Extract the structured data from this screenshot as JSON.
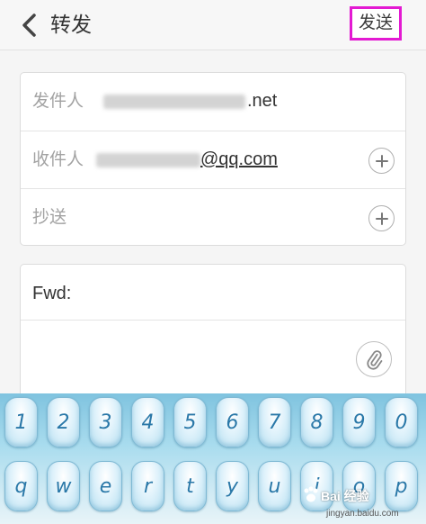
{
  "header": {
    "title": "转发",
    "send_label": "发送"
  },
  "form": {
    "from_label": "发件人",
    "from_value": ".net",
    "to_label": "收件人",
    "to_value": "@qq.com",
    "cc_label": "抄送",
    "subject_value": "Fwd:"
  },
  "keyboard": {
    "row1": [
      "1",
      "2",
      "3",
      "4",
      "5",
      "6",
      "7",
      "8",
      "9",
      "0"
    ],
    "row2": [
      "q",
      "w",
      "e",
      "r",
      "t",
      "y",
      "u",
      "i",
      "o",
      "p"
    ]
  },
  "watermark": {
    "text": "Bai 经验",
    "url": "jingyan.baidu.com"
  }
}
